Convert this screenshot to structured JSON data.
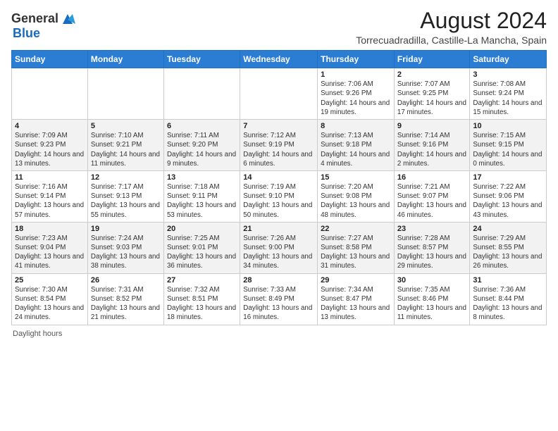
{
  "header": {
    "logo_general": "General",
    "logo_blue": "Blue",
    "main_title": "August 2024",
    "subtitle": "Torrecuadradilla, Castille-La Mancha, Spain"
  },
  "days_of_week": [
    "Sunday",
    "Monday",
    "Tuesday",
    "Wednesday",
    "Thursday",
    "Friday",
    "Saturday"
  ],
  "weeks": [
    [
      {
        "day": "",
        "info": ""
      },
      {
        "day": "",
        "info": ""
      },
      {
        "day": "",
        "info": ""
      },
      {
        "day": "",
        "info": ""
      },
      {
        "day": "1",
        "info": "Sunrise: 7:06 AM\nSunset: 9:26 PM\nDaylight: 14 hours and 19 minutes."
      },
      {
        "day": "2",
        "info": "Sunrise: 7:07 AM\nSunset: 9:25 PM\nDaylight: 14 hours and 17 minutes."
      },
      {
        "day": "3",
        "info": "Sunrise: 7:08 AM\nSunset: 9:24 PM\nDaylight: 14 hours and 15 minutes."
      }
    ],
    [
      {
        "day": "4",
        "info": "Sunrise: 7:09 AM\nSunset: 9:23 PM\nDaylight: 14 hours and 13 minutes."
      },
      {
        "day": "5",
        "info": "Sunrise: 7:10 AM\nSunset: 9:21 PM\nDaylight: 14 hours and 11 minutes."
      },
      {
        "day": "6",
        "info": "Sunrise: 7:11 AM\nSunset: 9:20 PM\nDaylight: 14 hours and 9 minutes."
      },
      {
        "day": "7",
        "info": "Sunrise: 7:12 AM\nSunset: 9:19 PM\nDaylight: 14 hours and 6 minutes."
      },
      {
        "day": "8",
        "info": "Sunrise: 7:13 AM\nSunset: 9:18 PM\nDaylight: 14 hours and 4 minutes."
      },
      {
        "day": "9",
        "info": "Sunrise: 7:14 AM\nSunset: 9:16 PM\nDaylight: 14 hours and 2 minutes."
      },
      {
        "day": "10",
        "info": "Sunrise: 7:15 AM\nSunset: 9:15 PM\nDaylight: 14 hours and 0 minutes."
      }
    ],
    [
      {
        "day": "11",
        "info": "Sunrise: 7:16 AM\nSunset: 9:14 PM\nDaylight: 13 hours and 57 minutes."
      },
      {
        "day": "12",
        "info": "Sunrise: 7:17 AM\nSunset: 9:13 PM\nDaylight: 13 hours and 55 minutes."
      },
      {
        "day": "13",
        "info": "Sunrise: 7:18 AM\nSunset: 9:11 PM\nDaylight: 13 hours and 53 minutes."
      },
      {
        "day": "14",
        "info": "Sunrise: 7:19 AM\nSunset: 9:10 PM\nDaylight: 13 hours and 50 minutes."
      },
      {
        "day": "15",
        "info": "Sunrise: 7:20 AM\nSunset: 9:08 PM\nDaylight: 13 hours and 48 minutes."
      },
      {
        "day": "16",
        "info": "Sunrise: 7:21 AM\nSunset: 9:07 PM\nDaylight: 13 hours and 46 minutes."
      },
      {
        "day": "17",
        "info": "Sunrise: 7:22 AM\nSunset: 9:06 PM\nDaylight: 13 hours and 43 minutes."
      }
    ],
    [
      {
        "day": "18",
        "info": "Sunrise: 7:23 AM\nSunset: 9:04 PM\nDaylight: 13 hours and 41 minutes."
      },
      {
        "day": "19",
        "info": "Sunrise: 7:24 AM\nSunset: 9:03 PM\nDaylight: 13 hours and 38 minutes."
      },
      {
        "day": "20",
        "info": "Sunrise: 7:25 AM\nSunset: 9:01 PM\nDaylight: 13 hours and 36 minutes."
      },
      {
        "day": "21",
        "info": "Sunrise: 7:26 AM\nSunset: 9:00 PM\nDaylight: 13 hours and 34 minutes."
      },
      {
        "day": "22",
        "info": "Sunrise: 7:27 AM\nSunset: 8:58 PM\nDaylight: 13 hours and 31 minutes."
      },
      {
        "day": "23",
        "info": "Sunrise: 7:28 AM\nSunset: 8:57 PM\nDaylight: 13 hours and 29 minutes."
      },
      {
        "day": "24",
        "info": "Sunrise: 7:29 AM\nSunset: 8:55 PM\nDaylight: 13 hours and 26 minutes."
      }
    ],
    [
      {
        "day": "25",
        "info": "Sunrise: 7:30 AM\nSunset: 8:54 PM\nDaylight: 13 hours and 24 minutes."
      },
      {
        "day": "26",
        "info": "Sunrise: 7:31 AM\nSunset: 8:52 PM\nDaylight: 13 hours and 21 minutes."
      },
      {
        "day": "27",
        "info": "Sunrise: 7:32 AM\nSunset: 8:51 PM\nDaylight: 13 hours and 18 minutes."
      },
      {
        "day": "28",
        "info": "Sunrise: 7:33 AM\nSunset: 8:49 PM\nDaylight: 13 hours and 16 minutes."
      },
      {
        "day": "29",
        "info": "Sunrise: 7:34 AM\nSunset: 8:47 PM\nDaylight: 13 hours and 13 minutes."
      },
      {
        "day": "30",
        "info": "Sunrise: 7:35 AM\nSunset: 8:46 PM\nDaylight: 13 hours and 11 minutes."
      },
      {
        "day": "31",
        "info": "Sunrise: 7:36 AM\nSunset: 8:44 PM\nDaylight: 13 hours and 8 minutes."
      }
    ]
  ],
  "footer": {
    "daylight_label": "Daylight hours"
  }
}
